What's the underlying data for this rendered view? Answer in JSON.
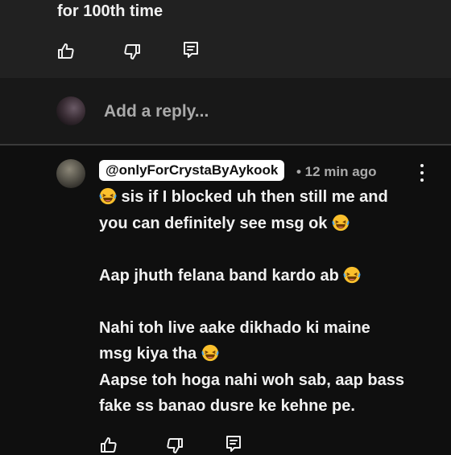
{
  "parent_comment": {
    "text_tail": "for 100th time",
    "actions": {
      "like": "thumbs-up-icon",
      "dislike": "thumbs-down-icon",
      "reply": "reply-icon"
    }
  },
  "reply_box": {
    "placeholder": "Add a reply..."
  },
  "comment": {
    "handle": "@onlyForCrystaByAykook",
    "time": "• 12 min ago",
    "emoji": "😂",
    "lines": [
      " sis if I blocked uh then still me and",
      "you can definitely see msg ok ",
      "Aap jhuth felana band kardo ab ",
      "Nahi toh live aake dikhado ki maine",
      "msg kiya tha ",
      "Aapse toh hoga nahi woh sab, aap bass",
      "fake ss banao dusre ke kehne pe."
    ]
  },
  "colors": {
    "background": "#0f0f0f",
    "parent_bg": "#212121",
    "reply_bg": "#181818",
    "muted_text": "#aaaaaa"
  }
}
